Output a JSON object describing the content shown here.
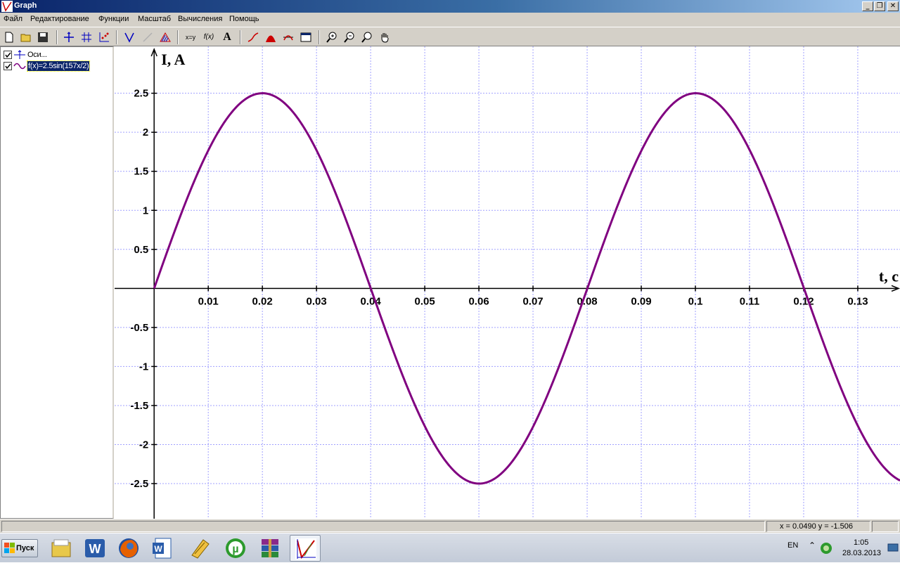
{
  "window": {
    "title": "Graph",
    "minimize": "_",
    "restore": "❐",
    "close": "✕"
  },
  "menu": [
    "Файл",
    "Редактирование",
    "Функции",
    "Масштаб",
    "Вычисления",
    "Помощь"
  ],
  "toolbar": {
    "xy_label": "x=y",
    "fx_label": "f(x)",
    "text_label": "A"
  },
  "tree": {
    "items": [
      {
        "label": "Оси...",
        "checked": true,
        "icon": "axes-icon"
      },
      {
        "label": "f(x)=2.5sin(157x/2)",
        "checked": true,
        "icon": "sine-wave-icon",
        "selected": true
      }
    ]
  },
  "chart_data": {
    "type": "line",
    "function": "f(x)=2.5sin(157x/2)",
    "amplitude": 2.5,
    "angular_frequency": 78.5,
    "xlabel": "t, c",
    "ylabel": "I, A",
    "xlim": [
      -0.0073,
      0.1378
    ],
    "ylim": [
      -2.95,
      3.1
    ],
    "x_ticks": [
      "0.01",
      "0.02",
      "0.03",
      "0.04",
      "0.05",
      "0.06",
      "0.07",
      "0.08",
      "0.09",
      "0.1",
      "0.11",
      "0.12",
      "0.13"
    ],
    "y_ticks": [
      "2.5",
      "2",
      "1.5",
      "1",
      "0.5",
      "-0.5",
      "-1",
      "-1.5",
      "-2",
      "-2.5"
    ],
    "grid": true,
    "line_color": "#800080",
    "grid_color": "#a0a0ff"
  },
  "status": {
    "coords": "x = 0.0490    y = -1.506"
  },
  "taskbar": {
    "start_label": "Пуск",
    "apps": [
      "file-manager-icon",
      "word-icon",
      "firefox-icon",
      "word-doc-icon",
      "pdf-icon",
      "utorrent-icon",
      "winrar-icon",
      "graph-app-icon"
    ],
    "language": "EN",
    "time": "1:05",
    "date": "28.03.2013"
  }
}
